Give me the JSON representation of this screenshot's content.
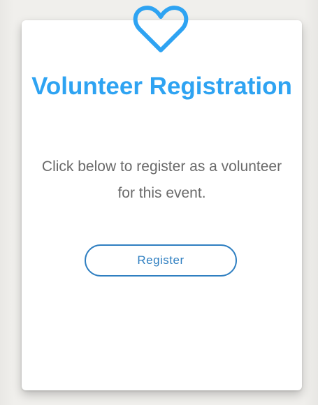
{
  "card": {
    "title": "Volunteer Registration",
    "description": "Click below to register as a volunteer for this event.",
    "button_label": "Register",
    "icon": "heart-icon"
  },
  "colors": {
    "accent": "#2ea3f2",
    "button": "#2f7fc1",
    "text": "#6a6a6a"
  }
}
